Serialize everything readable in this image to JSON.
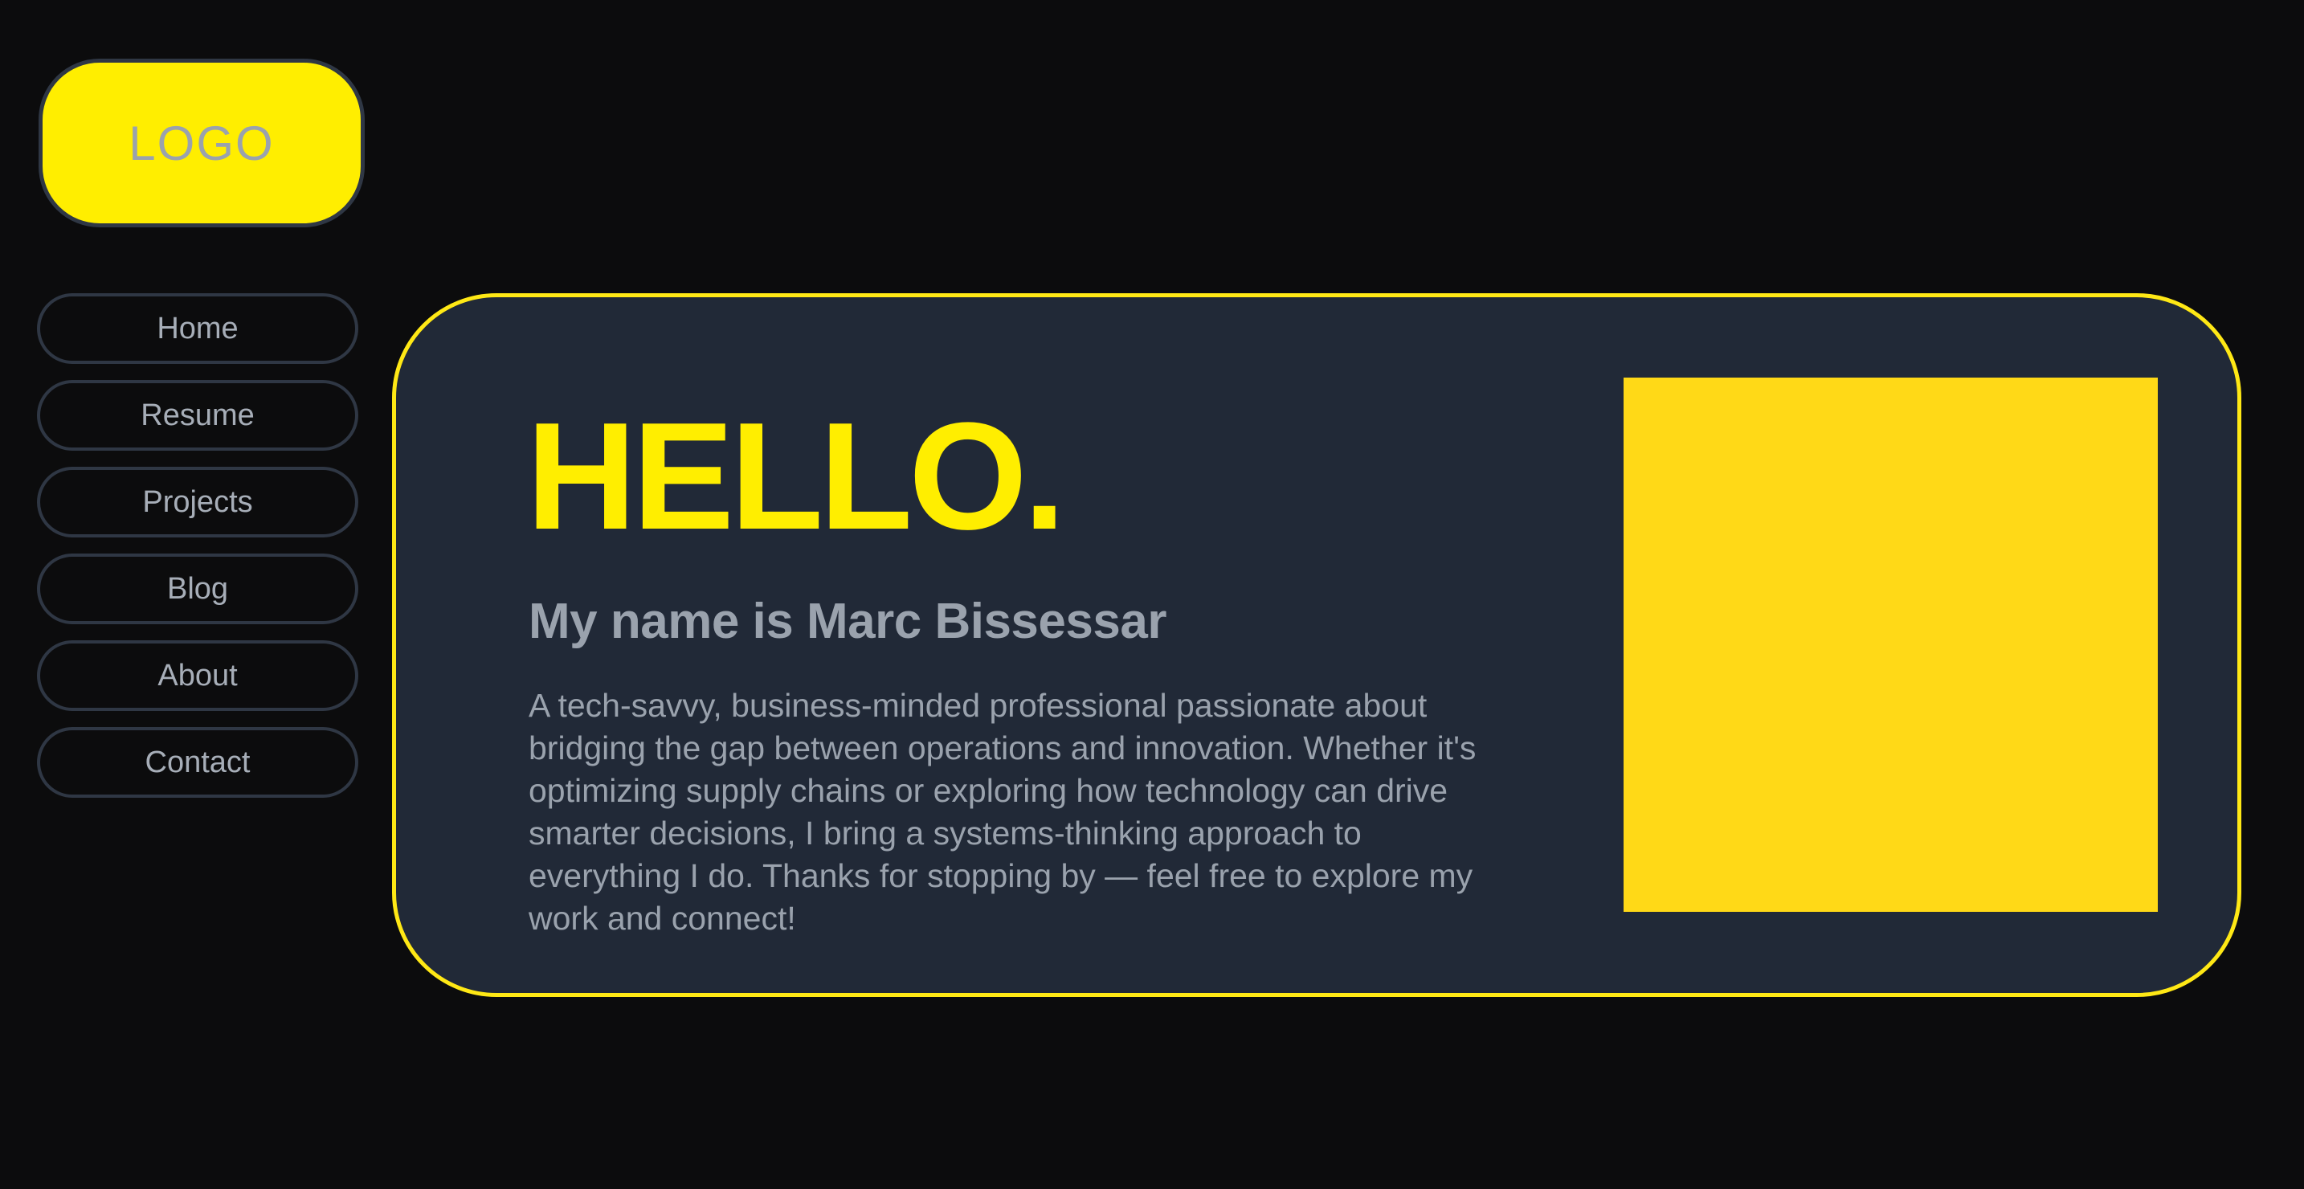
{
  "logo": {
    "text": "LOGO"
  },
  "nav": {
    "items": [
      {
        "label": "Home"
      },
      {
        "label": "Resume"
      },
      {
        "label": "Projects"
      },
      {
        "label": "Blog"
      },
      {
        "label": "About"
      },
      {
        "label": "Contact"
      }
    ]
  },
  "hero": {
    "greeting": "HELLO.",
    "name_line": "My name is Marc Bissessar",
    "bio": "A tech-savvy, business-minded professional passionate about bridging the gap between operations and innovation. Whether it's optimizing supply chains or exploring how technology can drive smarter decisions, I bring a systems-thinking approach to everything I do. Thanks for stopping by — feel free to explore my work and connect!"
  },
  "colors": {
    "background": "#0c0c0d",
    "accent_yellow": "#ffee00",
    "card_background": "#212937",
    "card_border": "#ffe815",
    "nav_border": "#2f3744",
    "text_gray": "#9aa2ad",
    "photo_placeholder": "#ffd917"
  }
}
